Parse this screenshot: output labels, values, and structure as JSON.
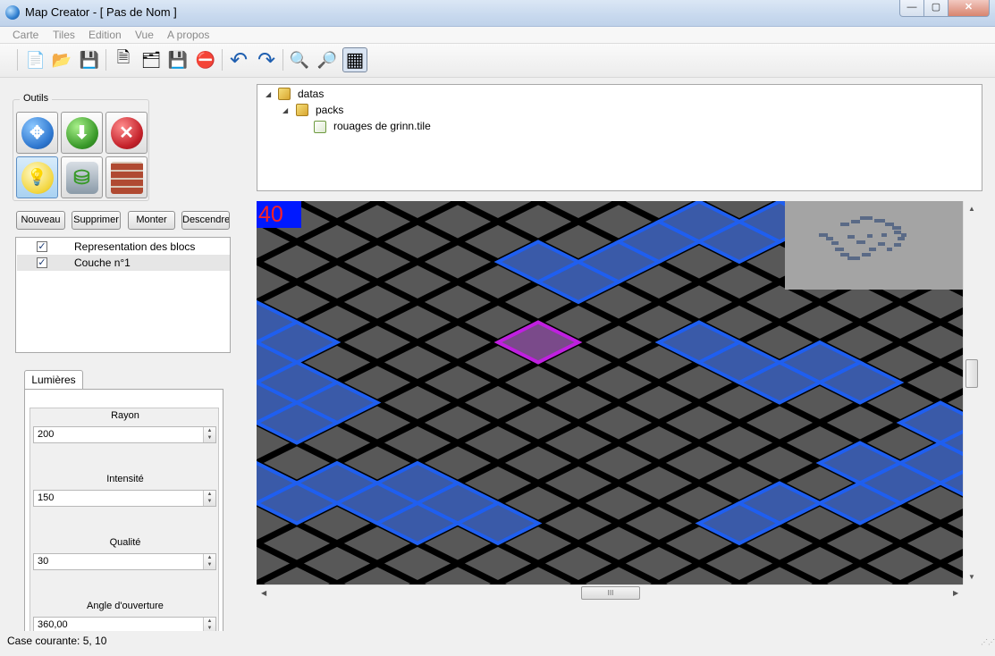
{
  "window": {
    "title": "Map Creator - [ Pas de Nom ]",
    "min": "—",
    "max": "▢",
    "close": "✕"
  },
  "menu": [
    "Carte",
    "Tiles",
    "Edition",
    "Vue",
    "A propos"
  ],
  "toolbar": {
    "buttons": [
      "new-map-icon",
      "open-folder-icon",
      "save-icon",
      "new-tile-icon",
      "open-tile-icon",
      "save-tile-icon",
      "delete-tile-icon",
      "undo-icon",
      "redo-icon",
      "zoom-out-icon",
      "zoom-in-icon",
      "grid-icon"
    ],
    "glyphs": {
      "new": "📄",
      "open": "📂",
      "save": "💾",
      "new_tile": "🗎",
      "open_tile": "🗂",
      "save_tile": "💾",
      "delete": "⛔",
      "undo": "↶",
      "redo": "↷",
      "zoom_out": "🔍",
      "zoom_in": "🔎",
      "grid": "▦"
    }
  },
  "tools": {
    "label": "Outils",
    "buttons": [
      {
        "name": "move-tool",
        "glyph": "✥",
        "color": "#2f78d0",
        "active": false
      },
      {
        "name": "add-tool",
        "glyph": "⬇",
        "color": "#3a9a2a",
        "active": false
      },
      {
        "name": "delete-tool",
        "glyph": "✕",
        "color": "#c4212a",
        "active": false
      },
      {
        "name": "light-tool",
        "glyph": "💡",
        "color": "#f2d53c",
        "active": true
      },
      {
        "name": "database-tool",
        "glyph": "⛁",
        "color": "#8a9aa8",
        "active": false
      },
      {
        "name": "wall-tool",
        "glyph": "▦",
        "color": "#b04a32",
        "active": false
      }
    ]
  },
  "layers": {
    "buttons": [
      "Nouveau",
      "Supprimer",
      "Monter",
      "Descendre"
    ],
    "items": [
      {
        "label": "Representation des blocs",
        "checked": "✓"
      },
      {
        "label": "Couche n°1",
        "checked": "✓"
      }
    ]
  },
  "lights": {
    "tab": "Lumières",
    "fields": [
      {
        "label": "Rayon",
        "value": "200"
      },
      {
        "label": "Intensité",
        "value": "150"
      },
      {
        "label": "Qualité",
        "value": "30"
      },
      {
        "label": "Angle d'ouverture",
        "value": "360,00"
      }
    ]
  },
  "tree": {
    "root": {
      "label": "datas",
      "arrow": "◢"
    },
    "child": {
      "label": "packs",
      "arrow": "◢"
    },
    "file": {
      "label": "rouages de grinn.tile"
    }
  },
  "map": {
    "fps": "40",
    "colors": {
      "background": "#4a4a4a",
      "tile": "#585858",
      "grid": "#000000",
      "selected": "#1f5ff0",
      "hover": "#c020e0",
      "fps_bg": "#0019ff",
      "fps_text": "#ff2222",
      "minimap_bg": "#a4a4a4"
    },
    "selected_tiles": [
      [
        7,
        1
      ],
      [
        8,
        1
      ],
      [
        6,
        2
      ],
      [
        7,
        2
      ],
      [
        8,
        2
      ],
      [
        9,
        2
      ],
      [
        5,
        3
      ],
      [
        6,
        3
      ],
      [
        8,
        3
      ],
      [
        9,
        3
      ],
      [
        10,
        3
      ],
      [
        4,
        4
      ],
      [
        5,
        4
      ],
      [
        9,
        4
      ],
      [
        10,
        4
      ],
      [
        11,
        4
      ],
      [
        4,
        5
      ],
      [
        11,
        5
      ],
      [
        12,
        5
      ],
      [
        13,
        5
      ],
      [
        0,
        7
      ],
      [
        12,
        7
      ],
      [
        13,
        7
      ],
      [
        14,
        7
      ],
      [
        0,
        8
      ],
      [
        1,
        8
      ],
      [
        6,
        8
      ],
      [
        12,
        8
      ],
      [
        13,
        8
      ],
      [
        14,
        8
      ],
      [
        0,
        9
      ],
      [
        6,
        9
      ],
      [
        7,
        9
      ],
      [
        12,
        9
      ],
      [
        13,
        9
      ],
      [
        0,
        10
      ],
      [
        1,
        10
      ],
      [
        7,
        10
      ],
      [
        8,
        10
      ],
      [
        12,
        10
      ],
      [
        13,
        10
      ],
      [
        14,
        10
      ],
      [
        0,
        11
      ],
      [
        1,
        11
      ],
      [
        12,
        11
      ],
      [
        13,
        11
      ],
      [
        14,
        11
      ],
      [
        0,
        12
      ],
      [
        1,
        12
      ],
      [
        9,
        12
      ],
      [
        10,
        12
      ],
      [
        9,
        13
      ],
      [
        10,
        13
      ],
      [
        8,
        14
      ],
      [
        9,
        14
      ],
      [
        0,
        15
      ],
      [
        1,
        15
      ],
      [
        2,
        15
      ],
      [
        8,
        15
      ],
      [
        9,
        15
      ],
      [
        1,
        16
      ],
      [
        2,
        16
      ],
      [
        3,
        16
      ],
      [
        7,
        16
      ],
      [
        8,
        16
      ],
      [
        2,
        17
      ],
      [
        3,
        17
      ],
      [
        6,
        17
      ]
    ],
    "hover_tile": [
      4,
      8
    ]
  },
  "scroll": {
    "up": "▲",
    "down": "▼",
    "left": "◀",
    "right": "▶",
    "thumb": "III"
  },
  "status": {
    "text": "Case courante: 5, 10"
  }
}
